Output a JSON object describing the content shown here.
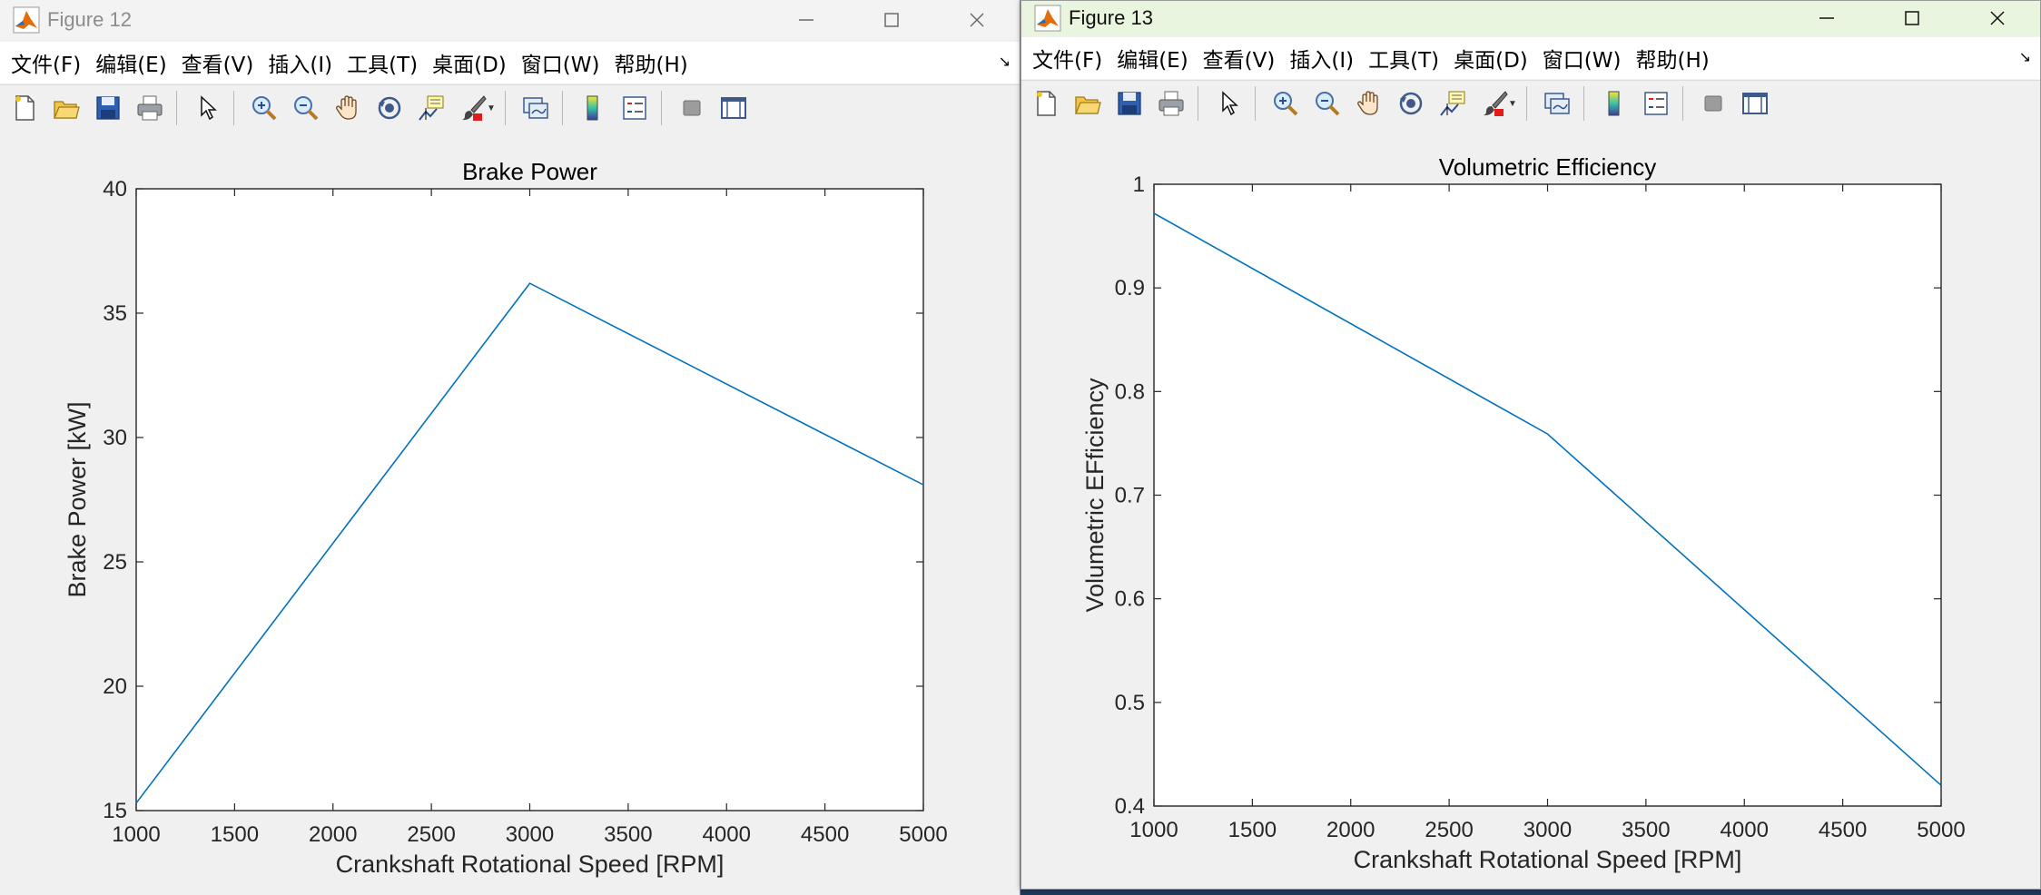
{
  "colors": {
    "line": "#0072bd",
    "axes": "#262626",
    "plot_bg": "#ffffff",
    "figure_bg": "#f0f0f0"
  },
  "menu": [
    "文件(F)",
    "编辑(E)",
    "查看(V)",
    "插入(I)",
    "工具(T)",
    "桌面(D)",
    "窗口(W)",
    "帮助(H)"
  ],
  "toolbar_icons": [
    "new-figure-icon",
    "open-file-icon",
    "save-icon",
    "print-icon",
    "pointer-icon",
    "zoom-in-icon",
    "zoom-out-icon",
    "pan-icon",
    "rotate-3d-icon",
    "data-cursor-icon",
    "brush-icon",
    "link-plot-icon",
    "colorbar-icon",
    "legend-icon",
    "hide-plot-tools-icon",
    "show-plot-tools-icon"
  ],
  "window_controls": [
    "minimize-icon",
    "maximize-icon",
    "close-icon"
  ],
  "figures": [
    {
      "title": "Figure 12",
      "chart_data": {
        "type": "line",
        "title": "Brake Power",
        "xlabel": "Crankshaft Rotational Speed [RPM]",
        "ylabel": "Brake Power [kW]",
        "xlim": [
          1000,
          5000
        ],
        "ylim": [
          15,
          40
        ],
        "xticks": [
          1000,
          1500,
          2000,
          2500,
          3000,
          3500,
          4000,
          4500,
          5000
        ],
        "yticks": [
          15,
          20,
          25,
          30,
          35,
          40
        ],
        "grid": false,
        "series": [
          {
            "x": [
              1000,
              3000,
              5000
            ],
            "y": [
              15.3,
              36.2,
              28.1
            ]
          }
        ]
      }
    },
    {
      "title": "Figure 13",
      "chart_data": {
        "type": "line",
        "title": "Volumetric Efficiency",
        "xlabel": "Crankshaft Rotational Speed [RPM]",
        "ylabel": "Volumetric EFficiency",
        "xlim": [
          1000,
          5000
        ],
        "ylim": [
          0.4,
          1
        ],
        "xticks": [
          1000,
          1500,
          2000,
          2500,
          3000,
          3500,
          4000,
          4500,
          5000
        ],
        "yticks": [
          0.4,
          0.5,
          0.6,
          0.7,
          0.8,
          0.9,
          1
        ],
        "grid": false,
        "series": [
          {
            "x": [
              1000,
              3000,
              5000
            ],
            "y": [
              0.972,
              0.759,
              0.42
            ]
          }
        ]
      }
    }
  ]
}
